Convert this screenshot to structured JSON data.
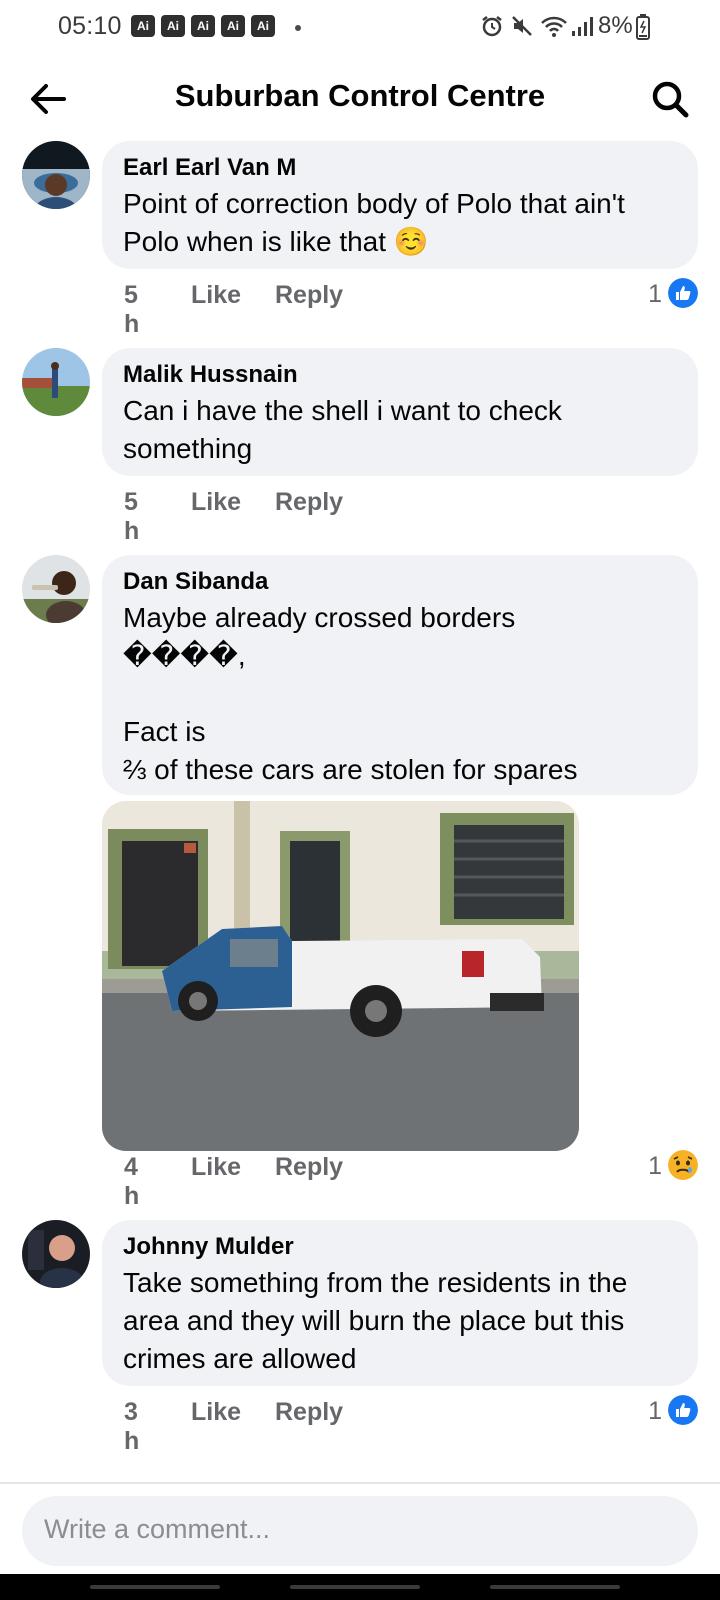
{
  "status_bar": {
    "time": "05:10",
    "ai_badges": [
      "Ai",
      "Ai",
      "Ai",
      "Ai",
      "Ai"
    ],
    "battery": "8%",
    "icons": [
      "alarm-icon",
      "mute-icon",
      "wifi-icon",
      "signal-icon",
      "battery-icon"
    ]
  },
  "header": {
    "title": "Suburban Control Centre",
    "back_icon": "arrow-left-icon",
    "search_icon": "search-icon"
  },
  "comments": [
    {
      "author": "Earl Earl Van M",
      "text": "Point of correction body of Polo that ain't Polo when is like that ☺️",
      "time": "5 h",
      "like_label": "Like",
      "reply_label": "Reply",
      "reaction_count": "1",
      "reaction": "like-icon"
    },
    {
      "author": "Malik Hussnain",
      "text": "Can i have the shell i want to check something",
      "time": "5 h",
      "like_label": "Like",
      "reply_label": "Reply"
    },
    {
      "author": "Dan Sibanda",
      "text": "Maybe already crossed borders\n����,\n\nFact is\n⅔ of these cars are stolen for spares",
      "time": "4 h",
      "like_label": "Like",
      "reply_label": "Reply",
      "reaction_count": "1",
      "reaction": "sad-face-icon"
    },
    {
      "author": "Johnny Mulder",
      "text": "Take something from the residents in the area and they will burn the place but this crimes are allowed",
      "time": "3 h",
      "like_label": "Like",
      "reply_label": "Reply",
      "reaction_count": "1",
      "reaction": "like-icon"
    }
  ],
  "composer": {
    "placeholder": "Write a comment..."
  },
  "colors": {
    "bubble": "#f0f2f5",
    "meta_text": "#65676b",
    "like_blue": "#1877f2",
    "sad_yellow": "#f7b125"
  }
}
